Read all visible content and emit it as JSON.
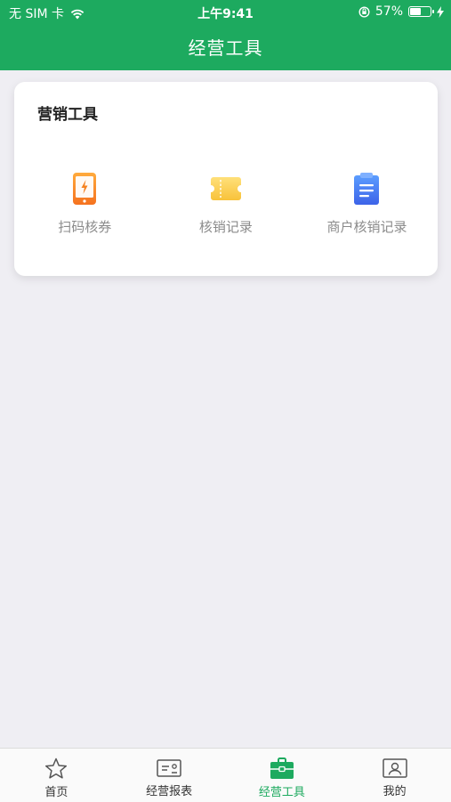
{
  "status": {
    "carrier": "无 SIM 卡",
    "time": "上午9:41",
    "battery_percent": "57%",
    "battery_level": 0.57
  },
  "header": {
    "title": "经营工具"
  },
  "card": {
    "title": "营销工具",
    "items": [
      {
        "label": "扫码核券",
        "icon": "phone-scan-icon"
      },
      {
        "label": "核销记录",
        "icon": "ticket-icon"
      },
      {
        "label": "商户核销记录",
        "icon": "document-icon"
      }
    ]
  },
  "tabbar": {
    "items": [
      {
        "label": "首页",
        "icon": "star-icon"
      },
      {
        "label": "经营报表",
        "icon": "report-icon"
      },
      {
        "label": "经营工具",
        "icon": "toolbox-icon",
        "active": true
      },
      {
        "label": "我的",
        "icon": "profile-icon"
      }
    ]
  },
  "colors": {
    "brand": "#1daa5f",
    "background": "#efeef3"
  }
}
